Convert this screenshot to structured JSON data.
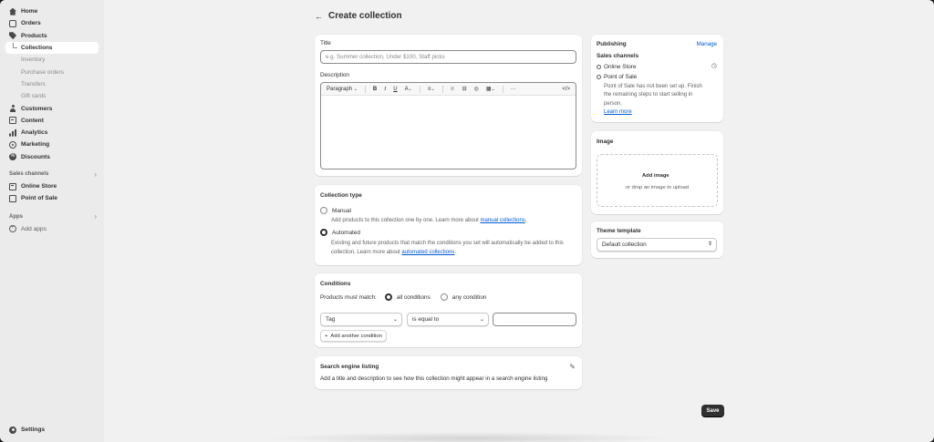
{
  "sidebar": {
    "items": [
      {
        "label": "Home",
        "icon": "home-icon"
      },
      {
        "label": "Orders",
        "icon": "orders-icon"
      },
      {
        "label": "Products",
        "icon": "tag-icon"
      }
    ],
    "product_subitems": [
      "Collections",
      "Inventory",
      "Purchase orders",
      "Transfers",
      "Gift cards"
    ],
    "items2": [
      {
        "label": "Customers",
        "icon": "person-icon"
      },
      {
        "label": "Content",
        "icon": "content-icon"
      },
      {
        "label": "Analytics",
        "icon": "bar-chart-icon"
      },
      {
        "label": "Marketing",
        "icon": "target-icon"
      },
      {
        "label": "Discounts",
        "icon": "discount-icon"
      }
    ],
    "sales_channels_label": "Sales channels",
    "channels": [
      "Online Store",
      "Point of Sale"
    ],
    "apps_label": "Apps",
    "add_apps": "Add apps",
    "settings": "Settings"
  },
  "header": {
    "back": "←",
    "title": "Create collection"
  },
  "main": {
    "title_label": "Title",
    "title_placeholder": "e.g. Summer collection, Under $100, Staff picks",
    "description_label": "Description",
    "toolbar_paragraph": "Paragraph",
    "collection_type": {
      "heading": "Collection type",
      "manual_label": "Manual",
      "manual_desc": "Add products to this collection one by one. Learn more about",
      "manual_link": "manual collections",
      "automated_label": "Automated",
      "automated_desc1": "Existing and future products that match the conditions you set will automatically be added to this",
      "automated_desc2": "collection. Learn more about",
      "automated_link": "automated collections",
      "selected": "Automated"
    },
    "conditions": {
      "heading": "Conditions",
      "match_label": "Products must match:",
      "all": "all conditions",
      "any": "any condition",
      "selected": "all conditions",
      "field": "Tag",
      "operator": "is equal to",
      "value": "",
      "add": "Add another condition"
    },
    "seo": {
      "heading": "Search engine listing",
      "desc": "Add a title and description to see how this collection might appear in a search engine listing"
    }
  },
  "right": {
    "publishing": {
      "heading": "Publishing",
      "manage": "Manage",
      "channels_label": "Sales channels",
      "channel1": "Online Store",
      "channel2": "Point of Sale",
      "pos_note1": "Point of Sale has not been set up. Finish",
      "pos_note2": "the remaining steps to start selling in",
      "pos_note3": "person.",
      "learn_more": "Learn more"
    },
    "image": {
      "heading": "Image",
      "add": "Add image",
      "drop": "or drop an image to upload"
    },
    "theme": {
      "heading": "Theme template",
      "value": "Default collection"
    }
  },
  "save_label": "Save",
  "colors": {
    "accent": "#005bd3",
    "primary_button": "#303030",
    "background": "#f1f1f1",
    "sidebar": "#ebebeb"
  }
}
